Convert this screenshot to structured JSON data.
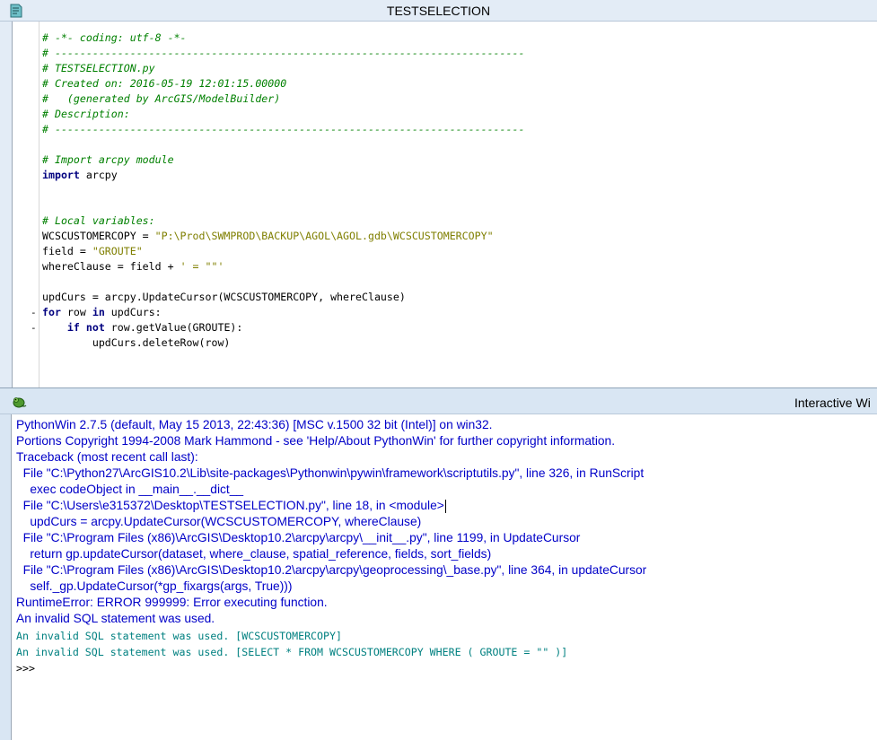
{
  "editor": {
    "title": "TESTSELECTION",
    "icon": "python-document-icon",
    "code_lines": [
      "# -*- coding: utf-8 -*-",
      "# ---------------------------------------------------------------------------",
      "# TESTSELECTION.py",
      "# Created on: 2016-05-19 12:01:15.00000",
      "#   (generated by ArcGIS/ModelBuilder)",
      "# Description:",
      "# ---------------------------------------------------------------------------",
      "",
      "# Import arcpy module",
      "import arcpy",
      "",
      "",
      "# Local variables:",
      "WCSCUSTOMERCOPY = \"P:\\Prod\\SWMPROD\\BACKUP\\AGOL\\AGOL.gdb\\WCSCUSTOMERCOPY\"",
      "field = \"GROUTE\"",
      "whereClause = field + ' = \"\"'",
      "",
      "updCurs = arcpy.UpdateCursor(WCSCUSTOMERCOPY, whereClause)",
      "for row in updCurs:",
      "    if not row.getValue(GROUTE):",
      "        updCurs.deleteRow(row)"
    ],
    "fold_markers": [
      "-",
      "-"
    ]
  },
  "interactive": {
    "title": "Interactive Wi",
    "icon": "pythonwin-snake-icon",
    "output_lines": [
      "PythonWin 2.7.5 (default, May 15 2013, 22:43:36) [MSC v.1500 32 bit (Intel)] on win32.",
      "Portions Copyright 1994-2008 Mark Hammond - see 'Help/About PythonWin' for further copyright information.",
      "Traceback (most recent call last):",
      "  File \"C:\\Python27\\ArcGIS10.2\\Lib\\site-packages\\Pythonwin\\pywin\\framework\\scriptutils.py\", line 326, in RunScript",
      "    exec codeObject in __main__.__dict__",
      "  File \"C:\\Users\\e315372\\Desktop\\TESTSELECTION.py\", line 18, in <module>",
      "    updCurs = arcpy.UpdateCursor(WCSCUSTOMERCOPY, whereClause)",
      "  File \"C:\\Program Files (x86)\\ArcGIS\\Desktop10.2\\arcpy\\arcpy\\__init__.py\", line 1199, in UpdateCursor",
      "    return gp.updateCursor(dataset, where_clause, spatial_reference, fields, sort_fields)",
      "  File \"C:\\Program Files (x86)\\ArcGIS\\Desktop10.2\\arcpy\\arcpy\\geoprocessing\\_base.py\", line 364, in updateCursor",
      "    self._gp.UpdateCursor(*gp_fixargs(args, True)))",
      "RuntimeError: ERROR 999999: Error executing function.",
      "An invalid SQL statement was used."
    ],
    "mono_lines": [
      "An invalid SQL statement was used. [WCSCUSTOMERCOPY]",
      "An invalid SQL statement was used. [SELECT * FROM WCSCUSTOMERCOPY WHERE ( GROUTE = \"\" )]"
    ],
    "prompt": ">>>"
  }
}
